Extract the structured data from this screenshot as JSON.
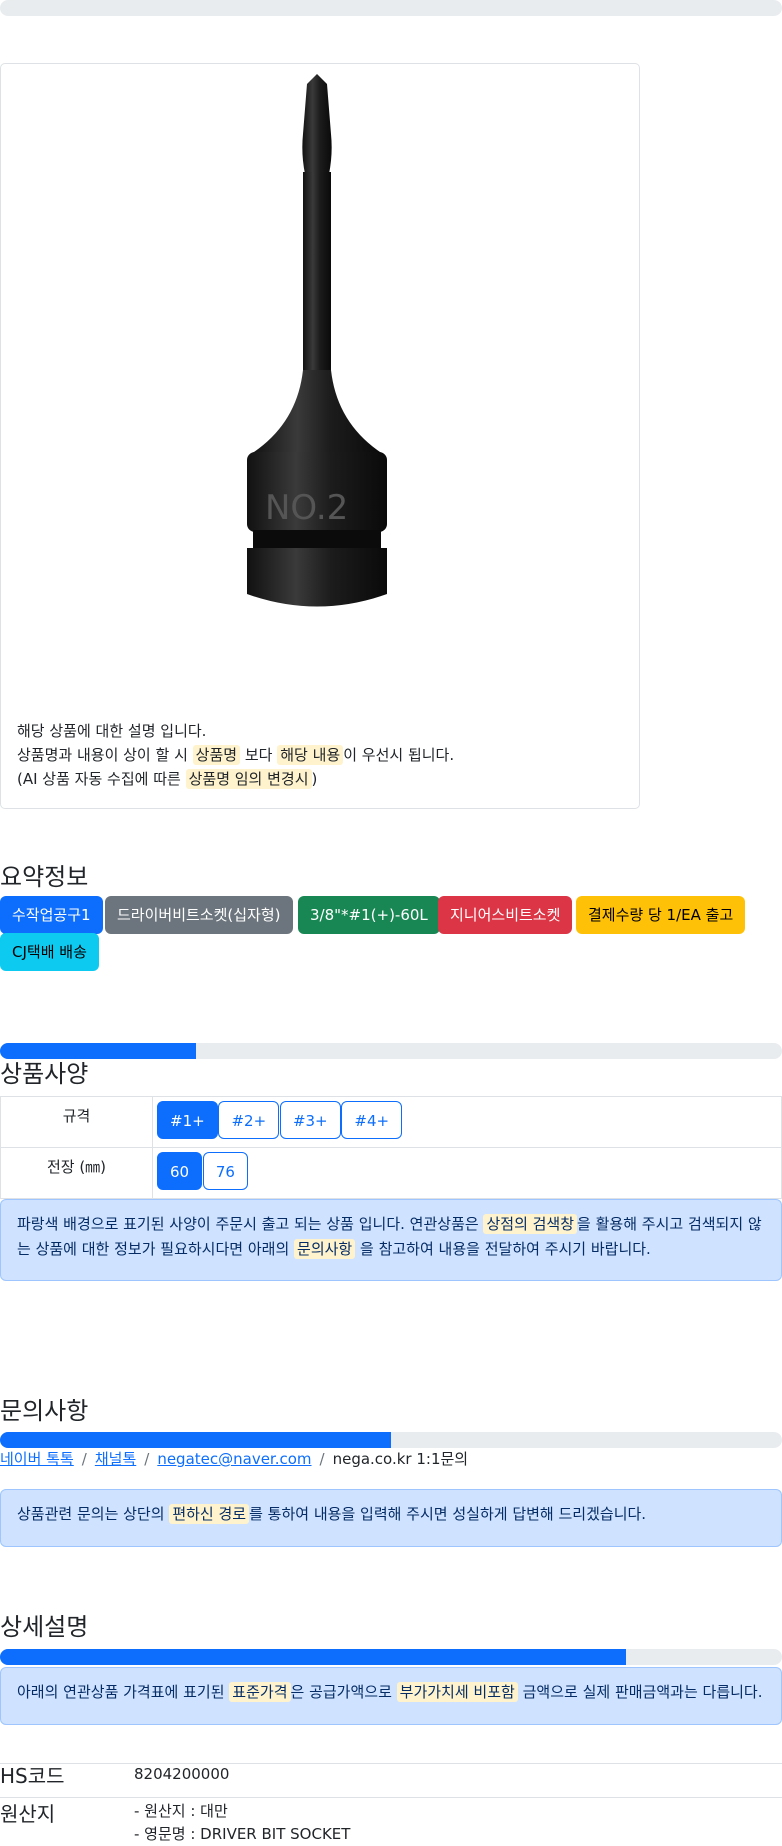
{
  "top_progress": {
    "value": 0
  },
  "card": {
    "lines": [
      "해당 상품에 대한 설명 입니다.",
      "상품명과 내용이 상이 할 시",
      "상품명",
      "보다",
      "해당 내용",
      "이 우선시 됩니다.",
      "(AI 상품 자동 수집에 따른",
      "상품명 임의 변경시",
      ")"
    ],
    "image_label": "NO.2"
  },
  "summary": {
    "title": "요약정보",
    "badges": [
      "수작업공구1",
      "드라이버비트소켓(십자형)",
      "3/8\"*#1(+)-60L",
      "지니어스비트소켓",
      "결제수량 당 1/EA 출고",
      "CJ택배 배송"
    ]
  },
  "spec": {
    "progress": 0.25,
    "title": "상품사양",
    "rows": [
      {
        "label": "규격",
        "options": [
          "#1+",
          "#2+",
          "#3+",
          "#4+"
        ],
        "selected": 0
      },
      {
        "label": "전장 (㎜)",
        "options": [
          "60",
          "76"
        ],
        "selected": 0
      }
    ],
    "notice": {
      "pre": "파랑색 배경으로 표기된 사양이 주문시 출고 되는 상품 입니다. 연관상품은",
      "hl1": "상점의 검색창",
      "mid": "을 활용해 주시고 검색되지 않는 상품에 대한 정보가 필요하시다면 아래의",
      "hl2": "문의사항",
      "post": "을 참고하여 내용을 전달하여 주시기 바랍니다."
    }
  },
  "inquiry": {
    "title": "문의사항",
    "progress": 0.5,
    "links": [
      "네이버 톡톡",
      "채널톡",
      "negatec@naver.com"
    ],
    "last": "nega.co.kr 1:1문의",
    "notice": {
      "pre": "상품관련 문의는 상단의",
      "hl": "편하신 경로",
      "post": "를 통하여 내용을 입력해 주시면 성실하게 답변해 드리겠습니다."
    }
  },
  "detail": {
    "title": "상세설명",
    "progress": 0.8,
    "notice": {
      "pre": "아래의 연관상품 가격표에 표기된",
      "hl1": "표준가격",
      "mid": "은 공급가액으로",
      "hl2": "부가가치세 비포함",
      "post": "금액으로 실제 판매금액과는 다릅니다."
    },
    "hs_label": "HS코드",
    "hs_value": "8204200000",
    "origin_label": "원산지",
    "origin_lines": [
      "- 원산지 : 대만",
      "- 영문명 : DRIVER BIT SOCKET"
    ]
  },
  "colors": {
    "primary": "#0d6efd",
    "secondary": "#6c757d",
    "success": "#198754",
    "danger": "#dc3545",
    "warning": "#ffc107",
    "info": "#0dcaf0",
    "alert_bg": "#cfe2ff",
    "highlight": "#fff3cd"
  }
}
